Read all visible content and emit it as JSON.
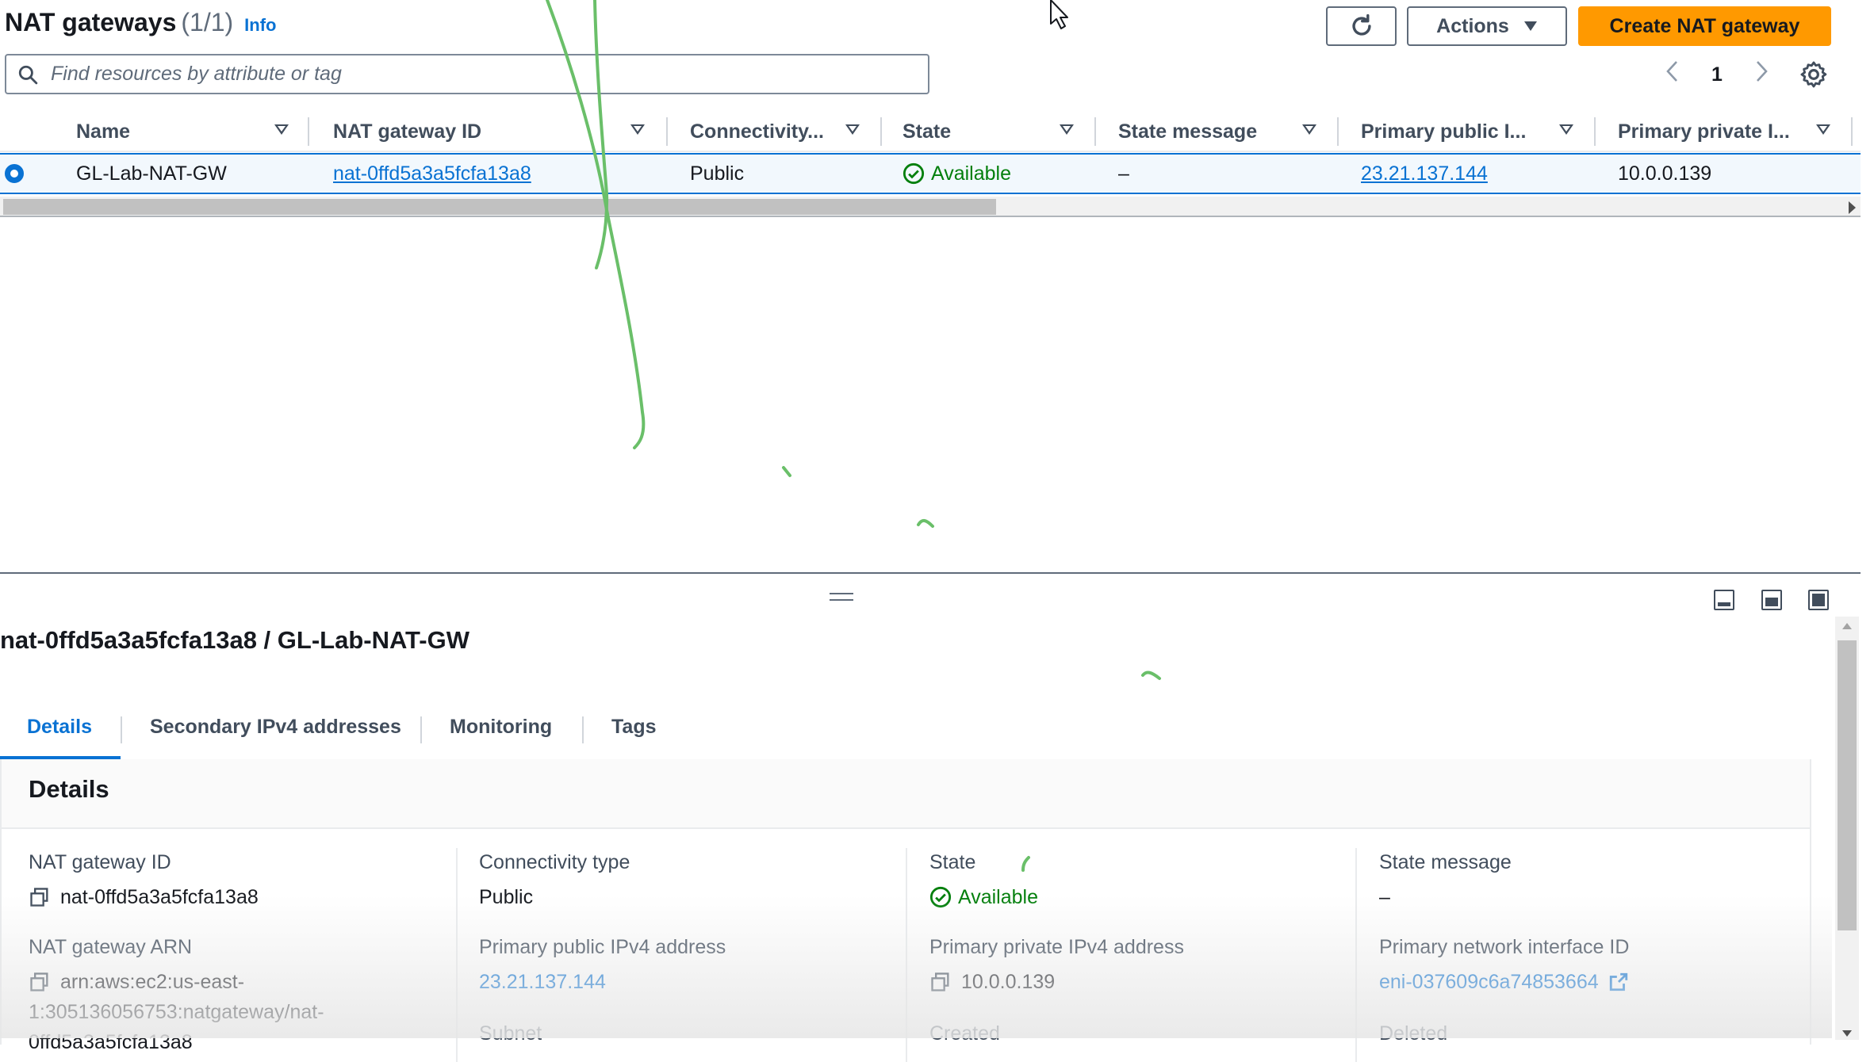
{
  "header": {
    "title": "NAT gateways",
    "count": "(1/1)",
    "info": "Info",
    "actions_label": "Actions",
    "create_label": "Create NAT gateway",
    "search_placeholder": "Find resources by attribute or tag",
    "page": "1"
  },
  "table": {
    "columns": [
      "Name",
      "NAT gateway ID",
      "Connectivity...",
      "State",
      "State message",
      "Primary public I...",
      "Primary private I..."
    ],
    "row": {
      "name": "GL-Lab-NAT-GW",
      "id": "nat-0ffd5a3a5fcfa13a8",
      "connectivity": "Public",
      "state": "Available",
      "state_message": "–",
      "public_ip": "23.21.137.144",
      "private_ip": "10.0.0.139"
    }
  },
  "panel": {
    "title": "nat-0ffd5a3a5fcfa13a8 / GL-Lab-NAT-GW",
    "tabs": [
      "Details",
      "Secondary IPv4 addresses",
      "Monitoring",
      "Tags"
    ],
    "section_title": "Details",
    "fields": {
      "gw_id_label": "NAT gateway ID",
      "gw_id": "nat-0ffd5a3a5fcfa13a8",
      "conn_label": "Connectivity type",
      "conn": "Public",
      "state_label": "State",
      "state": "Available",
      "state_msg_label": "State message",
      "state_msg": "–",
      "arn_label": "NAT gateway ARN",
      "arn_line1": "arn:aws:ec2:us-east-",
      "arn_line2": "1:305136056753:natgateway/nat-",
      "arn_line3": "0ffd5a3a5fcfa13a8",
      "pub_label": "Primary public IPv4 address",
      "pub": "23.21.137.144",
      "priv_label": "Primary private IPv4 address",
      "priv": "10.0.0.139",
      "eni_label": "Primary network interface ID",
      "eni": "eni-037609c6a74853664",
      "subnet_label": "Subnet",
      "created_label": "Created",
      "deleted_label": "Deleted"
    }
  },
  "colors": {
    "accent": "#0972d3",
    "primary_button": "#ff9900",
    "success": "#037f0c",
    "annotation": "#6abf69"
  }
}
